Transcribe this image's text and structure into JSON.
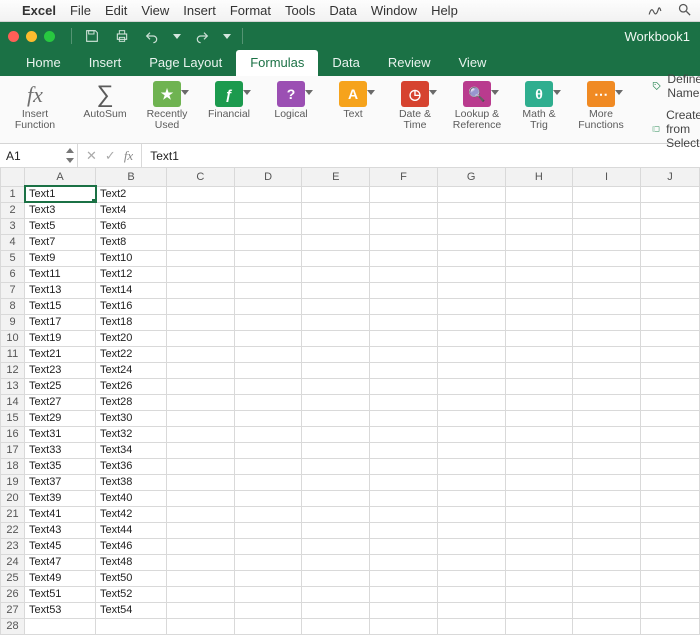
{
  "mac_menu": {
    "app": "Excel",
    "items": [
      "File",
      "Edit",
      "View",
      "Insert",
      "Format",
      "Tools",
      "Data",
      "Window",
      "Help"
    ]
  },
  "workbook_name": "Workbook1",
  "ribbon_tabs": [
    "Home",
    "Insert",
    "Page Layout",
    "Formulas",
    "Data",
    "Review",
    "View"
  ],
  "active_tab": "Formulas",
  "ribbon": {
    "insert_function": "Insert\nFunction",
    "autosum": "AutoSum",
    "recently_used": "Recently\nUsed",
    "financial": "Financial",
    "logical": "Logical",
    "text": "Text",
    "date_time": "Date &\nTime",
    "lookup": "Lookup &\nReference",
    "math_trig": "Math &\nTrig",
    "more_fns": "More\nFunctions",
    "define_name": "Define Name",
    "create_selection": "Create from Selection"
  },
  "namebox": "A1",
  "formula_value": "Text1",
  "columns": [
    "A",
    "B",
    "C",
    "D",
    "E",
    "F",
    "G",
    "H",
    "I",
    "J"
  ],
  "rows": [
    {
      "n": 1,
      "A": "Text1",
      "B": "Text2"
    },
    {
      "n": 2,
      "A": "Text3",
      "B": "Text4"
    },
    {
      "n": 3,
      "A": "Text5",
      "B": "Text6"
    },
    {
      "n": 4,
      "A": "Text7",
      "B": "Text8"
    },
    {
      "n": 5,
      "A": "Text9",
      "B": "Text10"
    },
    {
      "n": 6,
      "A": "Text11",
      "B": "Text12"
    },
    {
      "n": 7,
      "A": "Text13",
      "B": "Text14"
    },
    {
      "n": 8,
      "A": "Text15",
      "B": "Text16"
    },
    {
      "n": 9,
      "A": "Text17",
      "B": "Text18"
    },
    {
      "n": 10,
      "A": "Text19",
      "B": "Text20"
    },
    {
      "n": 11,
      "A": "Text21",
      "B": "Text22"
    },
    {
      "n": 12,
      "A": "Text23",
      "B": "Text24"
    },
    {
      "n": 13,
      "A": "Text25",
      "B": "Text26"
    },
    {
      "n": 14,
      "A": "Text27",
      "B": "Text28"
    },
    {
      "n": 15,
      "A": "Text29",
      "B": "Text30"
    },
    {
      "n": 16,
      "A": "Text31",
      "B": "Text32"
    },
    {
      "n": 17,
      "A": "Text33",
      "B": "Text34"
    },
    {
      "n": 18,
      "A": "Text35",
      "B": "Text36"
    },
    {
      "n": 19,
      "A": "Text37",
      "B": "Text38"
    },
    {
      "n": 20,
      "A": "Text39",
      "B": "Text40"
    },
    {
      "n": 21,
      "A": "Text41",
      "B": "Text42"
    },
    {
      "n": 22,
      "A": "Text43",
      "B": "Text44"
    },
    {
      "n": 23,
      "A": "Text45",
      "B": "Text46"
    },
    {
      "n": 24,
      "A": "Text47",
      "B": "Text48"
    },
    {
      "n": 25,
      "A": "Text49",
      "B": "Text50"
    },
    {
      "n": 26,
      "A": "Text51",
      "B": "Text52"
    },
    {
      "n": 27,
      "A": "Text53",
      "B": "Text54"
    },
    {
      "n": 28,
      "A": "",
      "B": ""
    }
  ],
  "selected": "A1"
}
